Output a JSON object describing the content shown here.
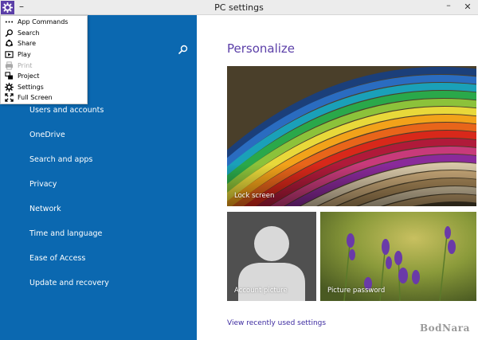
{
  "window": {
    "title": "PC settings",
    "menu_dash": "–",
    "minimize": "–",
    "close": "✕"
  },
  "menu": {
    "items": [
      {
        "label": "App Commands",
        "icon": "ellipsis-icon",
        "enabled": true
      },
      {
        "label": "Search",
        "icon": "search-icon",
        "enabled": true
      },
      {
        "label": "Share",
        "icon": "share-icon",
        "enabled": true
      },
      {
        "label": "Play",
        "icon": "play-icon",
        "enabled": true
      },
      {
        "label": "Print",
        "icon": "print-icon",
        "enabled": false
      },
      {
        "label": "Project",
        "icon": "project-icon",
        "enabled": true
      },
      {
        "label": "Settings",
        "icon": "gear-icon",
        "enabled": true
      },
      {
        "label": "Full Screen",
        "icon": "fullscreen-icon",
        "enabled": true
      }
    ]
  },
  "sidebar": {
    "items": [
      {
        "label": "Users and accounts"
      },
      {
        "label": "OneDrive"
      },
      {
        "label": "Search and apps"
      },
      {
        "label": "Privacy"
      },
      {
        "label": "Network"
      },
      {
        "label": "Time and language"
      },
      {
        "label": "Ease of Access"
      },
      {
        "label": "Update and recovery"
      }
    ]
  },
  "main": {
    "title": "Personalize",
    "tiles": {
      "lock_screen": "Lock screen",
      "account_picture": "Account picture",
      "picture_password": "Picture password"
    },
    "recent_link": "View recently used settings"
  },
  "watermark": "BodNara",
  "colors": {
    "accent": "#5b3fa8",
    "sidebar": "#0b68b0",
    "link": "#3d2ba0"
  }
}
